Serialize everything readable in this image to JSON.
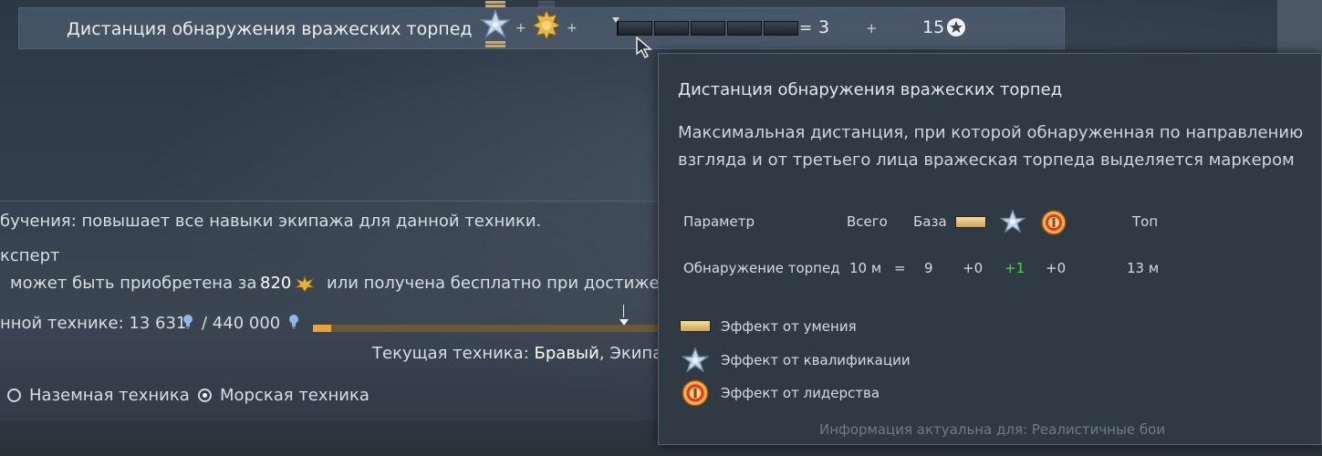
{
  "skill_row": {
    "title": "Дистанция обнаружения вражеских торпед",
    "plus_a": "+",
    "plus_b": "+",
    "equals": "=",
    "value": "3",
    "plus_c": "+",
    "cost": "15",
    "segments": 5,
    "filled_segments": 0
  },
  "background": {
    "line1": "бучения: повышает все навыки экипажа для данной техники.",
    "line2": "ксперт",
    "line3_a": "может быть приобретена за",
    "line3_price": "820",
    "line3_b": "или получена бесплатно при достиже",
    "line4_a": "нной технике: 13 631",
    "line4_b": "/ 440 000",
    "progress_fraction": 0.05,
    "current_label": "Текущая техника:",
    "current_vehicle": "Бравый",
    "current_tail": ", Экипаж",
    "radio_ground": "Наземная техника",
    "radio_naval": "Морская техника"
  },
  "tooltip": {
    "title": "Дистанция обнаружения вражеских торпед",
    "description": "Максимальная дистанция, при которой обнаруженная по направлению взгляда и от третьего лица вражеская торпеда выделяется маркером",
    "headers": {
      "param": "Параметр",
      "total": "Всего",
      "base": "База",
      "top": "Топ"
    },
    "row": {
      "param": "Обнаружение торпед",
      "total": "10 м",
      "equals": "=",
      "base": "9",
      "skill": "+0",
      "qualification": "+1",
      "leadership": "+0",
      "top": "13 м"
    },
    "legend": {
      "skill": "Эффект от умения",
      "qualification": "Эффект от квалификации",
      "leadership": "Эффект от лидерства"
    },
    "footer": "Информация актуальна для: Реалистичные бои"
  },
  "colors": {
    "accent_gold": "#e8a437",
    "positive_green": "#48d83a"
  },
  "icons": [
    "qualification-star-icon",
    "expert-badge-icon",
    "leadership-medal-icon",
    "skill-bar-icon",
    "eagle-icon",
    "rp-bulb-icon",
    "cost-star-icon",
    "mouse-cursor-icon"
  ]
}
